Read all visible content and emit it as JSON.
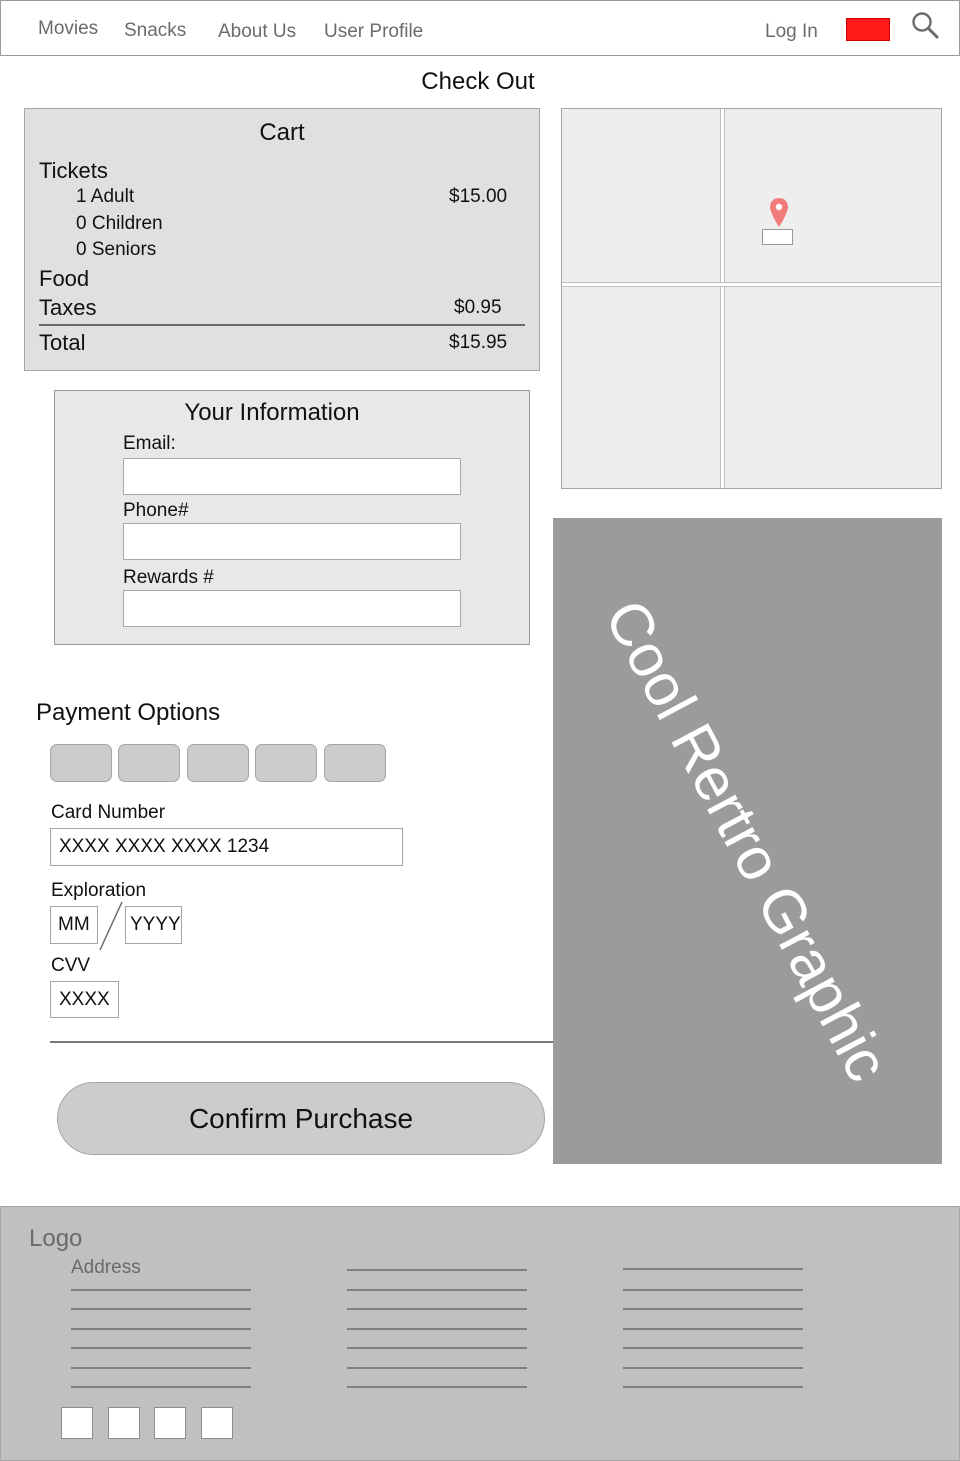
{
  "nav": {
    "items": [
      "Movies",
      "Snacks",
      "About Us",
      "User Profile"
    ],
    "login": "Log In",
    "flag_color": "#ff1a1a",
    "search_icon": "search-icon"
  },
  "page": {
    "title": "Check Out"
  },
  "cart": {
    "title": "Cart",
    "tickets_label": "Tickets",
    "adult_label": "1 Adult",
    "adult_price": "$15.00",
    "children_label": "0 Children",
    "seniors_label": "0 Seniors",
    "food_label": "Food",
    "taxes_label": "Taxes",
    "taxes_value": "$0.95",
    "total_label": "Total",
    "total_value": "$15.95"
  },
  "map": {
    "pin_icon": "map-pin-icon",
    "pin_color": "#f27b7b"
  },
  "info": {
    "title": "Your Information",
    "email_label": "Email:",
    "phone_label": "Phone#",
    "rewards_label": "Rewards #"
  },
  "payment": {
    "title": "Payment Options",
    "card_label": "Card Number",
    "card_value": "XXXX XXXX XXXX 1234",
    "exp_label": "Exploration",
    "exp_month": "MM",
    "exp_year": "YYYY",
    "cvv_label": "CVV",
    "cvv_value": "XXXX"
  },
  "confirm": {
    "label": "Confirm Purchase"
  },
  "graphic": {
    "text": "Cool Rertro Graphic"
  },
  "footer": {
    "logo": "Logo",
    "address": "Address"
  }
}
